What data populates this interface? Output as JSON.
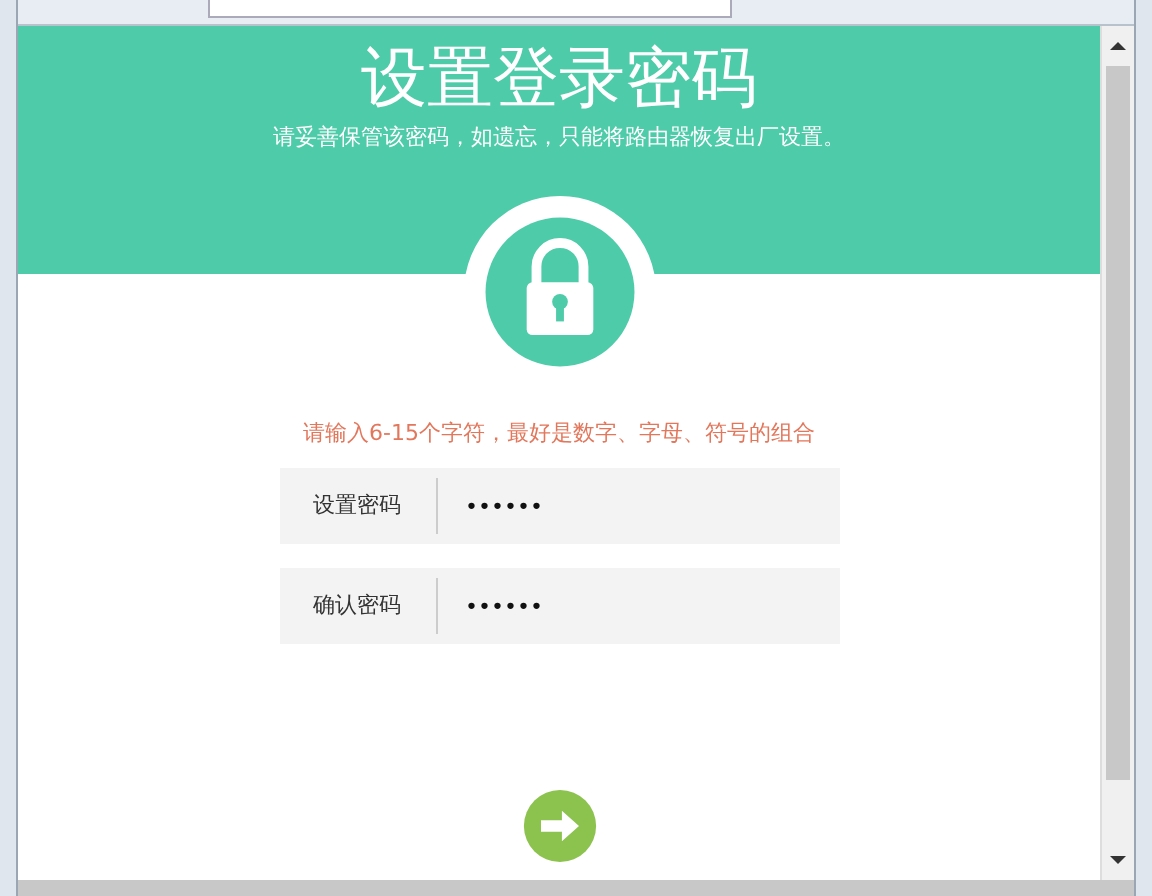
{
  "header": {
    "title": "设置登录密码",
    "subtitle": "请妥善保管该密码，如遗忘，只能将路由器恢复出厂设置。"
  },
  "hint": "请输入6-15个字符，最好是数字、字母、符号的组合",
  "fields": [
    {
      "label": "设置密码",
      "value": "••••••"
    },
    {
      "label": "确认密码",
      "value": "••••••"
    }
  ]
}
